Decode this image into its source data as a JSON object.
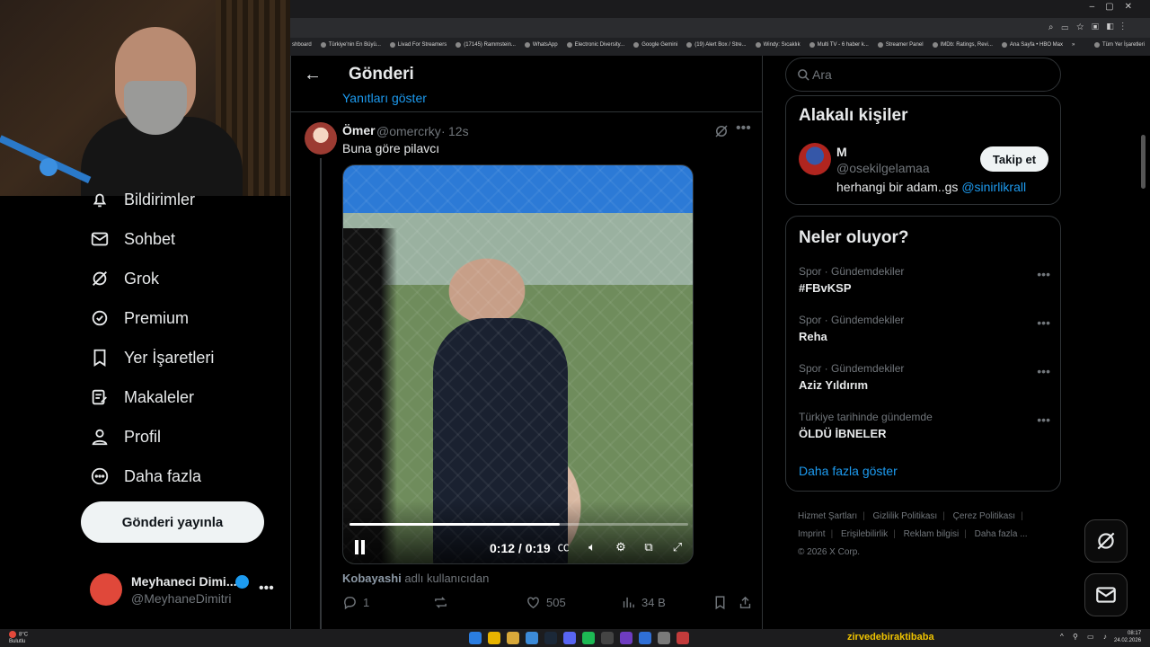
{
  "bookmarks": [
    "shboard",
    "Türkiye'nin En Büyü...",
    "Livad For Streamers",
    "(17145) Rammstein...",
    "WhatsApp",
    "Electronic Diversity...",
    "Google Gemini",
    "(19) Alert Box / Stre...",
    "Windy: Sıcaklık",
    "Multi TV - 6 haber k...",
    "Streamer Panel",
    "IMDb: Ratings, Revi...",
    "Ana Sayfa • HBO Max",
    "»",
    "Tüm Yer İşaretleri"
  ],
  "nav": {
    "items": [
      {
        "label": "Bildirimler",
        "icon": "bell-icon"
      },
      {
        "label": "Sohbet",
        "icon": "mail-icon"
      },
      {
        "label": "Grok",
        "icon": "grok-icon"
      },
      {
        "label": "Premium",
        "icon": "premium-badge-icon"
      },
      {
        "label": "Yer İşaretleri",
        "icon": "bookmark-icon"
      },
      {
        "label": "Makaleler",
        "icon": "article-icon"
      },
      {
        "label": "Profil",
        "icon": "person-icon"
      },
      {
        "label": "Daha fazla",
        "icon": "more-circle-icon"
      }
    ],
    "post_button": "Gönderi yayınla"
  },
  "account": {
    "name": "Meyhaneci Dimi...",
    "handle": "@MeyhaneDimitri"
  },
  "main": {
    "title": "Gönderi",
    "show_replies": "Yanıtları göster",
    "tweet": {
      "name": "Ömer",
      "handle": "@omercrky",
      "dot": "·",
      "time": "12s",
      "text": "Buna göre pilavcı",
      "video": {
        "time": "0:12 / 0:19",
        "progress": 0.62
      },
      "attrib_name": "Kobayashi",
      "attrib_suffix": "adlı kullanıcıdan",
      "replies": "1",
      "likes": "505",
      "views": "34 B"
    }
  },
  "search": {
    "placeholder": "Ara"
  },
  "related": {
    "title": "Alakalı kişiler",
    "name": "M",
    "handle": "@osekilgelamaa",
    "bio_text": "herhangi bir adam..gs",
    "bio_mention": "@sinirlikrall",
    "follow": "Takip et"
  },
  "trends": {
    "title": "Neler oluyor?",
    "items": [
      {
        "context": "Spor · Gündemdekiler",
        "topic": "#FBvKSP"
      },
      {
        "context": "Spor · Gündemdekiler",
        "topic": "Reha"
      },
      {
        "context": "Spor · Gündemdekiler",
        "topic": "Aziz Yıldırım"
      },
      {
        "context": "Türkiye tarihinde gündemde",
        "topic": "ÖLDÜ İBNELER"
      }
    ],
    "show_more": "Daha fazla göster"
  },
  "footer": {
    "links": [
      "Hizmet Şartları",
      "Gizlilik Politikası",
      "Çerez Politikası",
      "Imprint",
      "Erişilebilirlik",
      "Reklam bilgisi",
      "Daha fazla ..."
    ],
    "copyright": "© 2026 X Corp."
  },
  "taskbar": {
    "weather_temp": "8°C",
    "weather_desc": "Bulutlu",
    "watermark": "zirvedebiraktibaba",
    "time": "08:17",
    "date": "24.02.2026"
  },
  "colors": {
    "accent": "#1d9bf0",
    "background": "#000000",
    "text": "#e7e9ea",
    "muted": "#71767b",
    "border": "#2f3336"
  }
}
